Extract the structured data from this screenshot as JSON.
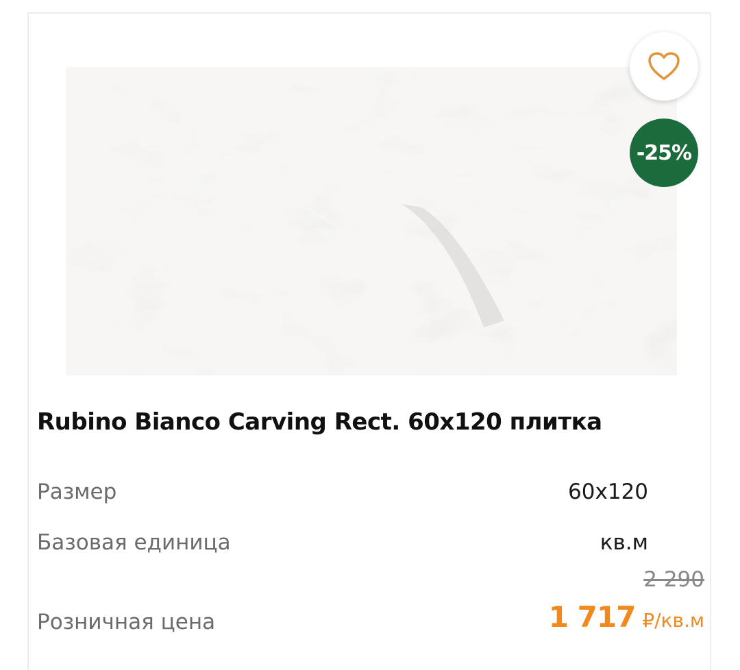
{
  "product": {
    "title": "Rubino Bianco Carving Rect. 60x120 плитка",
    "discount_badge": "-25%",
    "image_icon": "marble-tile-image",
    "favorite_icon": "heart-outline-icon"
  },
  "specs": [
    {
      "label": "Размер",
      "value": "60x120"
    },
    {
      "label": "Базовая единица",
      "value": "кв.м"
    }
  ],
  "price": {
    "label": "Розничная цена",
    "old_price": "2 290",
    "current_price": "1 717",
    "unit": "₽/кв.м"
  },
  "colors": {
    "accent_orange": "#f08a1c",
    "badge_green": "#1b6b3c",
    "heart_orange": "#e0963a"
  }
}
